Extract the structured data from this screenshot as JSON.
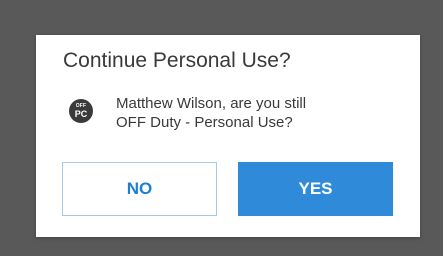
{
  "dialog": {
    "title": "Continue Personal Use?",
    "status_icon": {
      "name": "off-duty-personal-use-icon",
      "top_text": "OFF",
      "bottom_text": "PC"
    },
    "message_line1": "Matthew Wilson, are you still",
    "message_line2": "OFF Duty - Personal Use?",
    "no_label": "NO",
    "yes_label": "YES"
  },
  "colors": {
    "backdrop": "#595959",
    "dialog_bg": "#ffffff",
    "primary": "#2f8ad9",
    "text": "#3a3a3a"
  }
}
